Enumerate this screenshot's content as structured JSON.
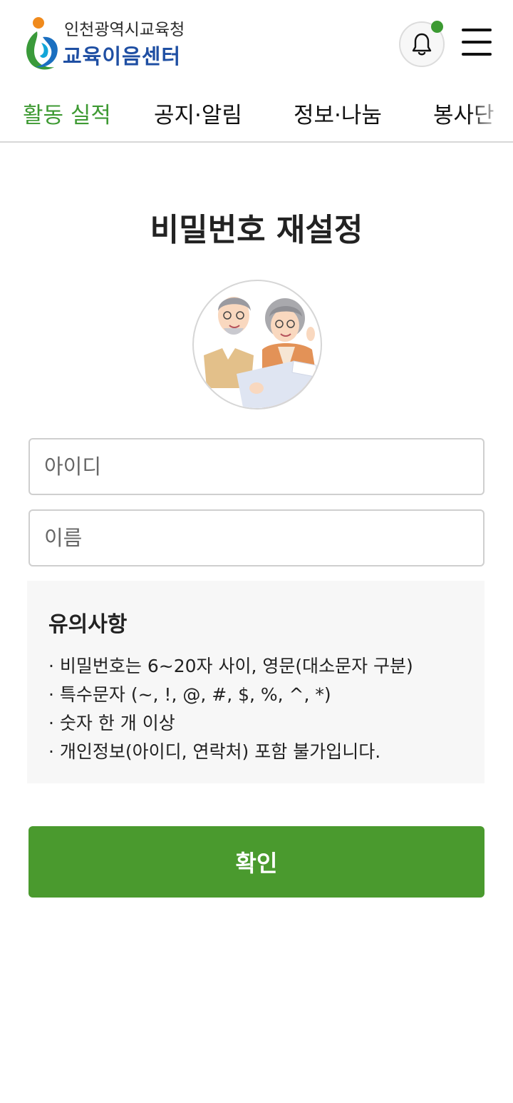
{
  "header": {
    "logo_top": "인천광역시교육청",
    "logo_bottom": "교육이음센터",
    "icons": {
      "bell": "bell-icon",
      "menu": "hamburger-menu-icon"
    },
    "notification_dot_color": "#3c9a32"
  },
  "tabs": [
    {
      "label": "활동 실적",
      "active": true
    },
    {
      "label": "공지·알림",
      "active": false
    },
    {
      "label": "정보·나눔",
      "active": false
    },
    {
      "label": "봉사단",
      "active": false
    }
  ],
  "page": {
    "title": "비밀번호 재설정"
  },
  "form": {
    "id_placeholder": "아이디",
    "name_placeholder": "이름"
  },
  "notice": {
    "title": "유의사항",
    "items": [
      "· 비밀번호는 6~20자 사이, 영문(대소문자 구분)",
      "· 특수문자 (~, !, @, #, $, %, ^, *)",
      "· 숫자 한 개 이상",
      "· 개인정보(아이디, 연락처) 포함 불가입니다."
    ]
  },
  "button": {
    "confirm_label": "확인"
  },
  "colors": {
    "accent": "#4a9a2e",
    "active_tab": "#3e9a33",
    "logo_blue": "#1f4fa3"
  }
}
